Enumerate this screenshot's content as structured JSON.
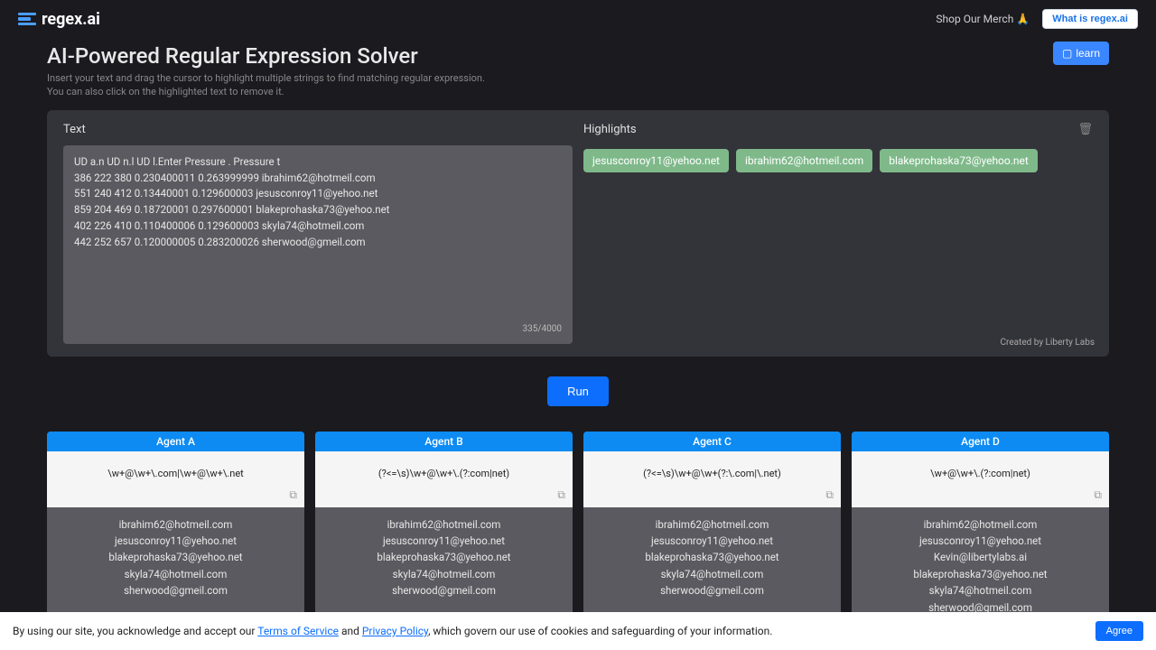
{
  "header": {
    "logo_text": "regex.ai",
    "merch": "Shop Our Merch 🙏",
    "what_button": "What is regex.ai"
  },
  "hero": {
    "title": "AI-Powered Regular Expression Solver",
    "subtitle_line1": "Insert your text and drag the cursor to highlight multiple strings to find matching regular expression.",
    "subtitle_line2": "You can also click on the highlighted text to remove it.",
    "learn_button": "learn"
  },
  "text_panel": {
    "label": "Text",
    "content": "UD a.n UD n.l UD l.Enter Pressure . Pressure t\n386 222 380 0.230400011 0.263999999 ibrahim62@hotmeil.com\n551 240 412 0.13440001 0.129600003 jesusconroy11@yehoo.net\n859 204 469 0.18720001 0.297600001 blakeprohaska73@yehoo.net\n402 226 410 0.110400006 0.129600003 skyla74@hotmeil.com\n442 252 657 0.120000005 0.283200026 sherwood@gmeil.com",
    "char_count": "335/4000"
  },
  "highlights": {
    "label": "Highlights",
    "chips": [
      "jesusconroy11@yehoo.net",
      "ibrahim62@hotmeil.com",
      "blakeprohaska73@yehoo.net"
    ]
  },
  "credit": "Created by Liberty Labs",
  "run_button": "Run",
  "agents": [
    {
      "name": "Agent A",
      "regex": "\\w+@\\w+\\.com|\\w+@\\w+\\.net",
      "matches": [
        "ibrahim62@hotmeil.com",
        "jesusconroy11@yehoo.net",
        "blakeprohaska73@yehoo.net",
        "skyla74@hotmeil.com",
        "sherwood@gmeil.com"
      ]
    },
    {
      "name": "Agent B",
      "regex": "(?<=\\s)\\w+@\\w+\\.(?:com|net)",
      "matches": [
        "ibrahim62@hotmeil.com",
        "jesusconroy11@yehoo.net",
        "blakeprohaska73@yehoo.net",
        "skyla74@hotmeil.com",
        "sherwood@gmeil.com"
      ]
    },
    {
      "name": "Agent C",
      "regex": "(?<=\\s)\\w+@\\w+(?:\\.com|\\.net)",
      "matches": [
        "ibrahim62@hotmeil.com",
        "jesusconroy11@yehoo.net",
        "blakeprohaska73@yehoo.net",
        "skyla74@hotmeil.com",
        "sherwood@gmeil.com"
      ]
    },
    {
      "name": "Agent D",
      "regex": "\\w+@\\w+\\.(?:com|net)",
      "matches": [
        "ibrahim62@hotmeil.com",
        "jesusconroy11@yehoo.net",
        "Kevin@libertylabs.ai",
        "blakeprohaska73@yehoo.net",
        "skyla74@hotmeil.com",
        "sherwood@gmeil.com"
      ]
    }
  ],
  "cookie": {
    "prefix": "By using our site, you acknowledge and accept our ",
    "terms": "Terms of Service",
    "mid": " and ",
    "privacy": "Privacy Policy",
    "suffix": ", which govern our use of cookies and safeguarding of your information.",
    "agree": "Agree"
  }
}
